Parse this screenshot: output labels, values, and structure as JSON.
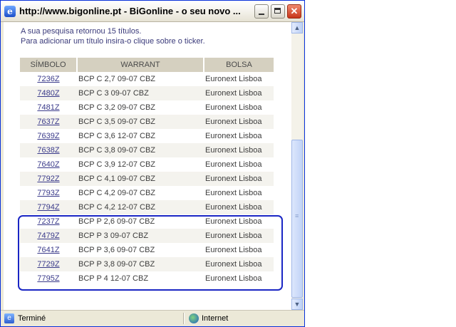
{
  "window": {
    "title": "http://www.bigonline.pt - BiGonline - o seu novo ...",
    "minimize_glyph": "",
    "maximize_glyph": "",
    "close_glyph": "✕"
  },
  "info": {
    "line1": "A sua pesquisa retornou 15 títulos.",
    "line2": "Para adicionar um título insira-o clique sobre o ticker."
  },
  "table": {
    "headers": [
      "SÍMBOLO",
      "WARRANT",
      "BOLSA"
    ],
    "rows": [
      {
        "symbol": "7236Z",
        "warrant": "BCP C 2,7 09-07 CBZ",
        "bolsa": "Euronext Lisboa"
      },
      {
        "symbol": "7480Z",
        "warrant": "BCP C 3 09-07 CBZ",
        "bolsa": "Euronext Lisboa"
      },
      {
        "symbol": "7481Z",
        "warrant": "BCP C 3,2 09-07 CBZ",
        "bolsa": "Euronext Lisboa"
      },
      {
        "symbol": "7637Z",
        "warrant": "BCP C 3,5 09-07 CBZ",
        "bolsa": "Euronext Lisboa"
      },
      {
        "symbol": "7639Z",
        "warrant": "BCP C 3,6 12-07 CBZ",
        "bolsa": "Euronext Lisboa"
      },
      {
        "symbol": "7638Z",
        "warrant": "BCP C 3,8 09-07 CBZ",
        "bolsa": "Euronext Lisboa"
      },
      {
        "symbol": "7640Z",
        "warrant": "BCP C 3,9 12-07 CBZ",
        "bolsa": "Euronext Lisboa"
      },
      {
        "symbol": "7792Z",
        "warrant": "BCP C 4,1 09-07 CBZ",
        "bolsa": "Euronext Lisboa"
      },
      {
        "symbol": "7793Z",
        "warrant": "BCP C 4,2 09-07 CBZ",
        "bolsa": "Euronext Lisboa"
      },
      {
        "symbol": "7794Z",
        "warrant": "BCP C 4,2 12-07 CBZ",
        "bolsa": "Euronext Lisboa"
      },
      {
        "symbol": "7237Z",
        "warrant": "BCP P 2,6 09-07 CBZ",
        "bolsa": "Euronext Lisboa"
      },
      {
        "symbol": "7479Z",
        "warrant": "BCP P 3 09-07 CBZ",
        "bolsa": "Euronext Lisboa"
      },
      {
        "symbol": "7641Z",
        "warrant": "BCP P 3,6 09-07 CBZ",
        "bolsa": "Euronext Lisboa"
      },
      {
        "symbol": "7729Z",
        "warrant": "BCP P 3,8 09-07 CBZ",
        "bolsa": "Euronext Lisboa"
      },
      {
        "symbol": "7795Z",
        "warrant": "BCP P 4 12-07 CBZ",
        "bolsa": "Euronext Lisboa"
      }
    ]
  },
  "scrollbar": {
    "up_glyph": "▲",
    "down_glyph": "▼",
    "grip_glyph": "≡"
  },
  "status": {
    "text": "Terminé",
    "zone": "Internet"
  },
  "colors": {
    "highlight_border": "#1a26c4",
    "header_bg": "#d5d0c0",
    "link": "#3a3a8a"
  }
}
